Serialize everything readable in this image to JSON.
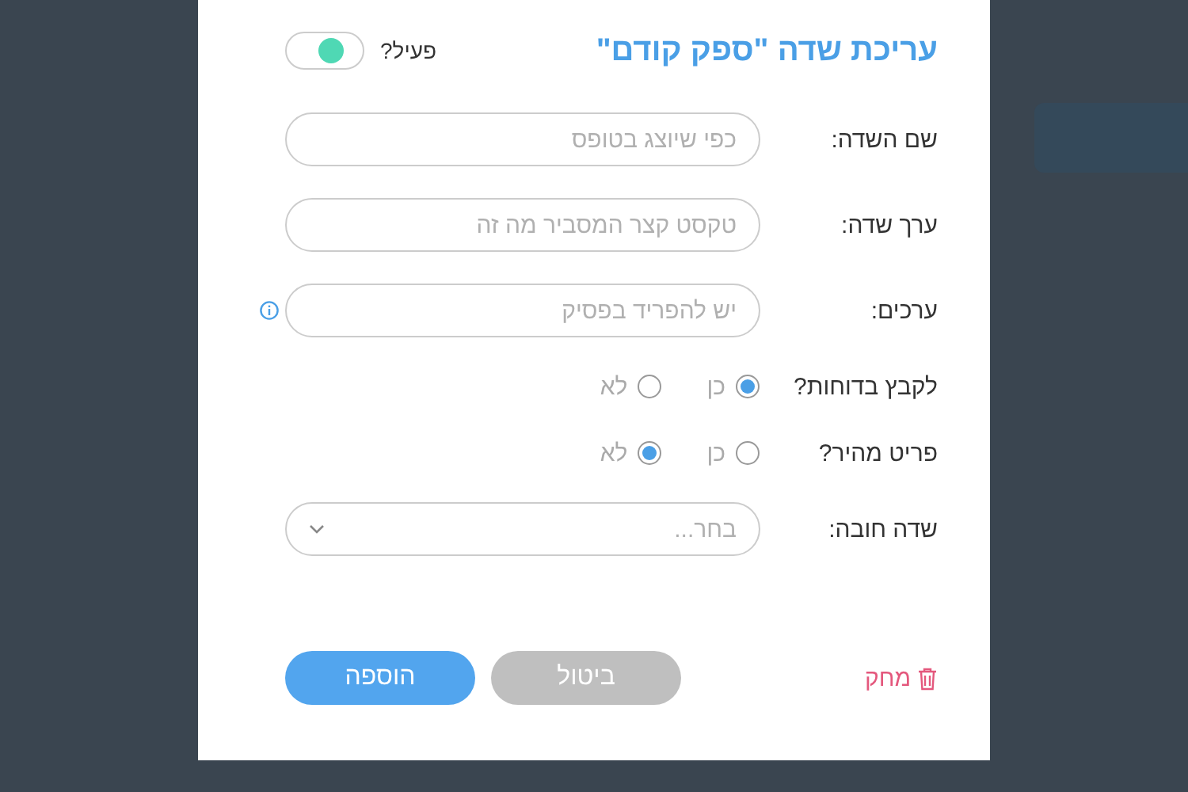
{
  "dialog": {
    "title": "עריכת שדה \"ספק קודם\"",
    "active": {
      "label": "פעיל?",
      "on": true
    }
  },
  "fields": [
    {
      "kind": "text",
      "label": "שם השדה:",
      "placeholder": "כפי שיוצג בטופס"
    },
    {
      "kind": "text",
      "label": "ערך שדה:",
      "placeholder": "טקסט קצר המסביר מה זה"
    },
    {
      "kind": "text",
      "label": "ערכים:",
      "placeholder": "יש להפריד בפסיק",
      "info": true
    },
    {
      "kind": "radio",
      "label": "לקבץ בדוחות?",
      "options": [
        {
          "label": "כן",
          "selected": true
        },
        {
          "label": "לא",
          "selected": false
        }
      ]
    },
    {
      "kind": "radio",
      "label": "פריט מהיר?",
      "options": [
        {
          "label": "כן",
          "selected": false
        },
        {
          "label": "לא",
          "selected": true
        }
      ]
    },
    {
      "kind": "select",
      "label": "שדה חובה:",
      "placeholder": "בחר..."
    }
  ],
  "actions": {
    "delete": "מחק",
    "cancel": "ביטול",
    "add": "הוספה"
  }
}
